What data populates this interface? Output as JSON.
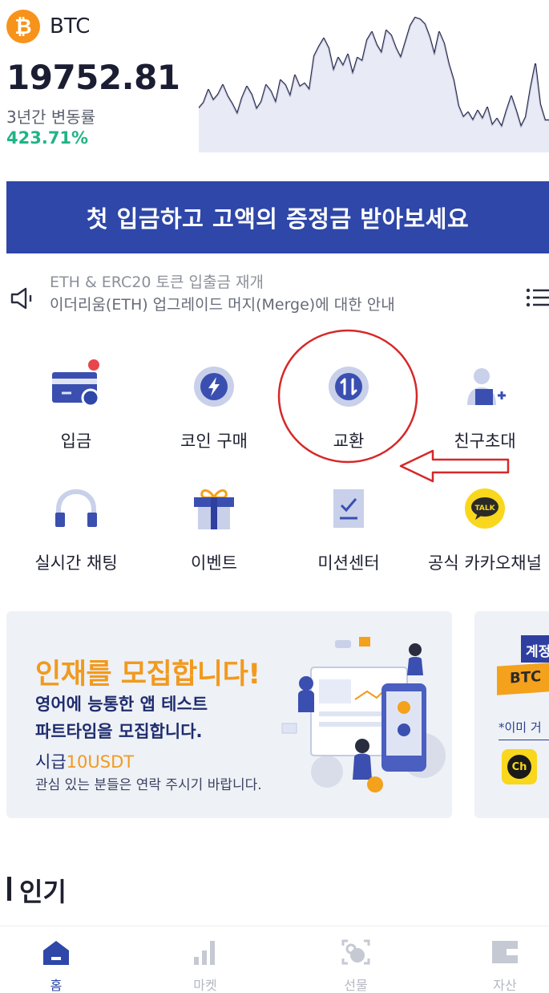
{
  "ticker": {
    "logo_letter": "₿",
    "symbol": "BTC",
    "price": "19752.81",
    "period_label": "3년간 변동률",
    "change": "423.71%"
  },
  "banner": {
    "text": "첫 입금하고 고액의 증정금 받아보세요"
  },
  "notice": {
    "line_top": "ETH & ERC20 토큰 입출금 재개",
    "line_main": "이더리움(ETH) 업그레이드 머지(Merge)에 대한 안내"
  },
  "quick_menu": [
    {
      "label": "입금",
      "icon": "deposit-card-icon",
      "has_badge": true
    },
    {
      "label": "코인 구매",
      "icon": "lightning-icon"
    },
    {
      "label": "교환",
      "icon": "swap-arrows-icon"
    },
    {
      "label": "친구초대",
      "icon": "add-friend-icon"
    },
    {
      "label": "실시간 채팅",
      "icon": "headset-icon"
    },
    {
      "label": "이벤트",
      "icon": "gift-icon"
    },
    {
      "label": "미션센터",
      "icon": "checklist-icon"
    },
    {
      "label": "공식 카카오채널",
      "icon": "kakao-talk-icon",
      "badge_text": "TALK"
    }
  ],
  "promo": {
    "title": "인재를 모집합니다!",
    "line1": "영어에 능통한 앱 테스트",
    "line2": "파트타임을 모집합니다.",
    "pay_prefix": "시급",
    "pay_value": "10USDT",
    "sub": "관심 있는 분들은 연락 주시기 바랍니다."
  },
  "promo2": {
    "flag": "계정",
    "ribbon": "BTC",
    "note": "*이미 거",
    "kakao": "Ch"
  },
  "section": {
    "title": "인기"
  },
  "bottom_nav": [
    {
      "label": "홈",
      "icon": "home-icon",
      "active": true
    },
    {
      "label": "마켓",
      "icon": "market-bars-icon"
    },
    {
      "label": "선물",
      "icon": "futures-icon"
    },
    {
      "label": "자산",
      "icon": "wallet-icon"
    }
  ],
  "colors": {
    "brand_blue": "#2e47a8",
    "positive_green": "#20b486",
    "btc_orange": "#f7931a",
    "accent_orange": "#f19a1e",
    "annotation_red": "#d62828"
  }
}
